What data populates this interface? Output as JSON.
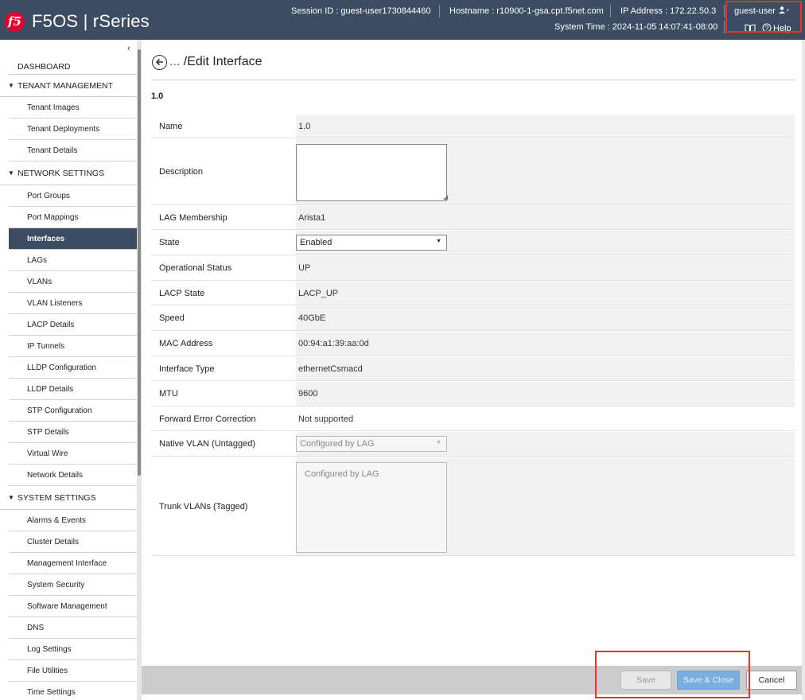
{
  "header": {
    "logo_text": "f5",
    "app_title": "F5OS | rSeries",
    "session_id": "Session ID : guest-user1730844460",
    "hostname": "Hostname : r10900-1-gsa.cpt.f5net.com",
    "ip_address": "IP Address : 172.22.50.3",
    "system_time": "System Time : 2024-11-05 14:07:41-08:00",
    "user": "guest-user",
    "help": "Help"
  },
  "sidebar": {
    "collapse": "‹",
    "dashboard": "DASHBOARD",
    "tenant_management": {
      "label": "TENANT MANAGEMENT",
      "items": [
        "Tenant Images",
        "Tenant Deployments",
        "Tenant Details"
      ]
    },
    "network_settings": {
      "label": "NETWORK SETTINGS",
      "items": [
        "Port Groups",
        "Port Mappings",
        "Interfaces",
        "LAGs",
        "VLANs",
        "VLAN Listeners",
        "LACP Details",
        "IP Tunnels",
        "LLDP Configuration",
        "LLDP Details",
        "STP Configuration",
        "STP Details",
        "Virtual Wire",
        "Network Details"
      ]
    },
    "system_settings": {
      "label": "SYSTEM SETTINGS",
      "items": [
        "Alarms & Events",
        "Cluster Details",
        "Management Interface",
        "System Security",
        "Software Management",
        "DNS",
        "Log Settings",
        "File Utilities",
        "Time Settings"
      ]
    },
    "active_item": "Interfaces"
  },
  "main": {
    "breadcrumb_dots": "...",
    "breadcrumb_title": " /Edit Interface",
    "interface_name": "1.0",
    "form": {
      "name_label": "Name",
      "name_value": "1.0",
      "description_label": "Description",
      "description_value": "",
      "lag_label": "LAG Membership",
      "lag_value": "Arista1",
      "state_label": "State",
      "state_value": "Enabled",
      "opstatus_label": "Operational Status",
      "opstatus_value": "UP",
      "lacp_label": "LACP State",
      "lacp_value": "LACP_UP",
      "speed_label": "Speed",
      "speed_value": "40GbE",
      "mac_label": "MAC Address",
      "mac_value": "00:94:a1:39:aa:0d",
      "type_label": "Interface Type",
      "type_value": "ethernetCsmacd",
      "mtu_label": "MTU",
      "mtu_value": "9600",
      "fec_label": "Forward Error Correction",
      "fec_value": "Not supported",
      "native_vlan_label": "Native VLAN (Untagged)",
      "native_vlan_value": "Configured by LAG",
      "trunk_vlans_label": "Trunk VLANs (Tagged)",
      "trunk_vlans_value": "Configured by LAG"
    }
  },
  "footer": {
    "save": "Save",
    "save_close": "Save & Close",
    "cancel": "Cancel"
  },
  "colors": {
    "header_bg": "#3b4c63",
    "active_nav": "#3b4c63",
    "highlight_box": "#e8332b",
    "primary_button": "#7aaee0",
    "logo_red": "#e4002b"
  }
}
